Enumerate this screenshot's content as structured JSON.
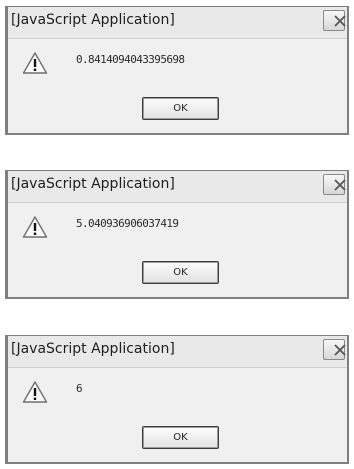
{
  "dialogs": [
    {
      "title": "[JavaScript Application]",
      "message": "0.8414094043395698",
      "ok_label": "OK",
      "icon": "warning-icon"
    },
    {
      "title": "[JavaScript Application]",
      "message": "5.040936906037419",
      "ok_label": "OK",
      "icon": "warning-icon"
    },
    {
      "title": "[JavaScript Application]",
      "message": "6",
      "ok_label": "OK",
      "icon": "warning-icon"
    }
  ],
  "colors": {
    "dialog_background": "#f0f0f0",
    "titlebar_background": "#e9e9e9",
    "border": "#7f7f7f"
  }
}
